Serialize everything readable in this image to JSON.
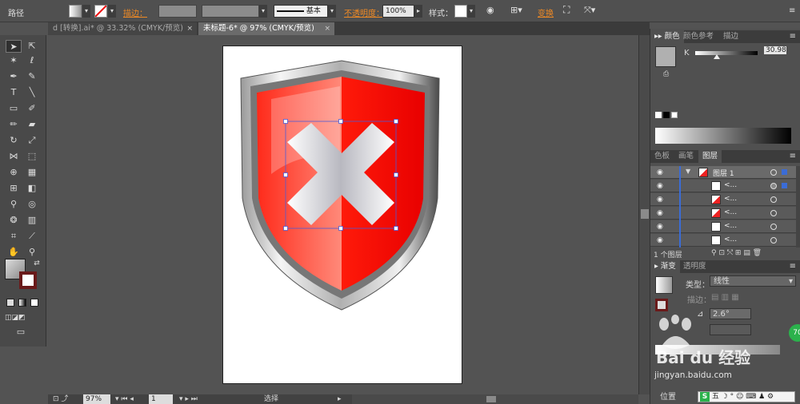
{
  "control_bar": {
    "object_type": "路径",
    "stroke_label": "描边：",
    "style_label": "基本",
    "opacity_label": "不透明度：",
    "opacity_value": "100%",
    "styles_label": "样式：",
    "transform_label": "变换"
  },
  "tabs": [
    {
      "label": "d [转换].ai* @ 33.32% (CMYK/预览)"
    },
    {
      "label": "未标题-6* @ 97% (CMYK/预览)"
    }
  ],
  "status_bar": {
    "zoom": "97%",
    "page": "1",
    "tool": "选择"
  },
  "color_panel": {
    "tabs": [
      "颜色",
      "颜色参考",
      "描边"
    ],
    "channel_label": "K",
    "value": "30.98",
    "value_fraction": 0.31
  },
  "layers_panel": {
    "tabs": [
      "色板",
      "画笔",
      "图层"
    ],
    "layer_name": "图层 1",
    "sublayer_label": "<...",
    "footer": "1 个图层"
  },
  "gradient_panel": {
    "tabs": [
      "渐变",
      "透明度"
    ],
    "type_label": "类型：",
    "type_value": "线性",
    "stroke_label": "描边：",
    "angle_value": "2.6°",
    "position_label": "位置"
  },
  "watermark": {
    "text": "Bai du 经验",
    "url": "jingyan.baidu.com"
  },
  "colors": {
    "shield_red": "#ff1a0a",
    "accent_orange": "#f08a24"
  }
}
